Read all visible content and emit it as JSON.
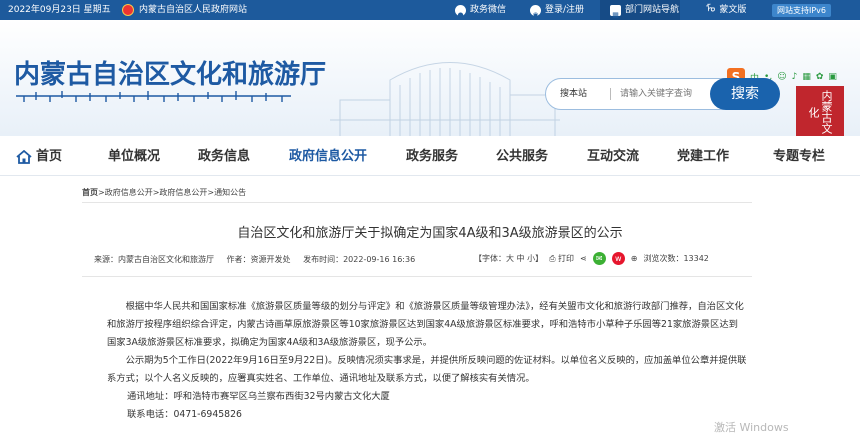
{
  "topbar": {
    "date": "2022年09月23日 星期五",
    "gov_site": "内蒙古自治区人民政府网站",
    "wechat": "政务微信",
    "login": "登录/注册",
    "dept_nav": "部门网站导航",
    "mongolian": "蒙文版",
    "ipv6": "网站支持IPv6"
  },
  "header": {
    "site_title": "内蒙古自治区文化和旅游厅",
    "search_scope": "搜本站",
    "search_placeholder": "请输入关键字查询",
    "search_button": "搜索",
    "seal_text": "内蒙古文化"
  },
  "nav": {
    "items": [
      "首页",
      "单位概况",
      "政务信息",
      "政府信息公开",
      "政务服务",
      "公共服务",
      "互动交流",
      "党建工作",
      "专题专栏"
    ],
    "active_index": 3
  },
  "breadcrumb": {
    "home": "首页",
    "path": ">政府信息公开>政府信息公开>通知公告"
  },
  "article": {
    "title": "自治区文化和旅游厅关于拟确定为国家4A级和3A级旅游景区的公示",
    "source": "来源：内蒙古自治区文化和旅游厅",
    "author": "作者：资源开发处",
    "date": "发布时间：2022-09-16 16:36",
    "font_size": "【字体：大 中 小】",
    "print": "打印",
    "views": "浏览次数：13342",
    "paragraphs": [
      "根据中华人民共和国国家标准《旅游景区质量等级的划分与评定》和《旅游景区质量等级管理办法》，经有关盟市文化和旅游行政部门推荐，自治区文化和旅游厅按程序组织综合评定，内蒙古诗画草原旅游景区等10家旅游景区达到国家4A级旅游景区标准要求，呼和浩特市小草种子乐园等21家旅游景区达到国家3A级旅游景区标准要求，拟确定为国家4A级和3A级旅游景区，现予公示。",
      "公示期为5个工作日(2022年9月16日至9月22日)。反映情况须实事求是，并提供所反映问题的佐证材料。以单位名义反映的，应加盖单位公章并提供联系方式；以个人名义反映的，应署真实姓名、工作单位、通讯地址及联系方式，以便了解核实有关情况。"
    ],
    "address": "通讯地址：呼和浩特市赛罕区乌兰察布西街32号内蒙古文化大厦",
    "phone": "联系电话：0471-6945826"
  },
  "watermark": "激活 Windows",
  "colors": {
    "topbar": "#1d5a9c",
    "accent": "#1e5aa3",
    "search_button": "#1a63ad"
  }
}
